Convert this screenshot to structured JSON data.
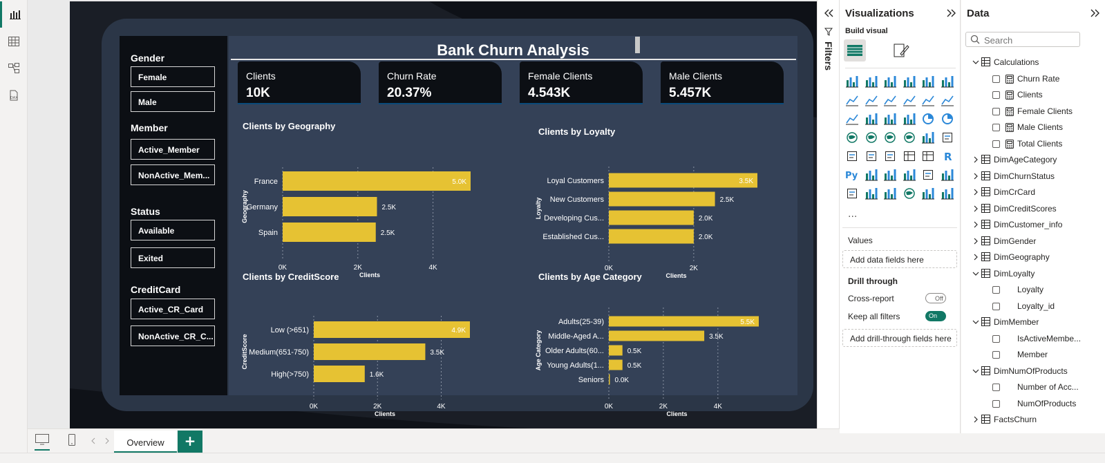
{
  "report": {
    "title": "Bank Churn Analysis",
    "slicers": [
      {
        "title": "Gender",
        "items": [
          "Female",
          "Male"
        ]
      },
      {
        "title": "Member",
        "items": [
          "Active_Member",
          "NonActive_Mem..."
        ]
      },
      {
        "title": "Status",
        "items": [
          "Available",
          "Exited"
        ]
      },
      {
        "title": "CreditCard",
        "items": [
          "Active_CR_Card",
          "NonActive_CR_C..."
        ]
      }
    ],
    "kpis": [
      {
        "label": "Clients",
        "value": "10K"
      },
      {
        "label": "Churn Rate",
        "value": "20.37%"
      },
      {
        "label": "Female Clients",
        "value": "4.543K"
      },
      {
        "label": "Male Clients",
        "value": "5.457K"
      }
    ]
  },
  "chart_data": [
    {
      "type": "bar",
      "orientation": "horizontal",
      "title": "Clients by Geography",
      "xlabel": "Clients",
      "ylabel": "Geography",
      "categories": [
        "France",
        "Germany",
        "Spain"
      ],
      "values": [
        5014,
        2509,
        2477
      ],
      "data_labels": [
        "5.0K",
        "2.5K",
        "2.5K"
      ],
      "xticks": [
        "0K",
        "2K",
        "4K"
      ],
      "xlim": [
        0,
        5000
      ],
      "bar_color": "#e6c233"
    },
    {
      "type": "bar",
      "orientation": "horizontal",
      "title": "Clients by Loyalty",
      "xlabel": "Clients",
      "ylabel": "Loyalty",
      "categories": [
        "Loyal Customers",
        "New Customers",
        "Developing Cus...",
        "Established Cus..."
      ],
      "values": [
        3500,
        2500,
        2000,
        2000
      ],
      "data_labels": [
        "3.5K",
        "2.5K",
        "2.0K",
        "2.0K"
      ],
      "xticks": [
        "0K",
        "2K"
      ],
      "xlim": [
        0,
        3500
      ],
      "bar_color": "#e6c233"
    },
    {
      "type": "bar",
      "orientation": "horizontal",
      "title": "Clients by CreditScore",
      "xlabel": "Clients",
      "ylabel": "CreditScore",
      "categories": [
        "Low (>651)",
        "Medium(651-750)",
        "High(>750)"
      ],
      "values": [
        4900,
        3500,
        1600
      ],
      "data_labels": [
        "4.9K",
        "3.5K",
        "1.6K"
      ],
      "xticks": [
        "0K",
        "2K",
        "4K"
      ],
      "xlim": [
        0,
        4900
      ],
      "bar_color": "#e6c233"
    },
    {
      "type": "bar",
      "orientation": "horizontal",
      "title": "Clients by Age Category",
      "xlabel": "Clients",
      "ylabel": "Age Category",
      "categories": [
        "Adults(25-39)",
        "Middle-Aged A...",
        "Older Adults(60...",
        "Young Adults(1...",
        "Seniors"
      ],
      "values": [
        5500,
        3500,
        500,
        500,
        20
      ],
      "data_labels": [
        "5.5K",
        "3.5K",
        "0.5K",
        "0.5K",
        "0.0K"
      ],
      "xticks": [
        "0K",
        "2K",
        "4K"
      ],
      "xlim": [
        0,
        5500
      ],
      "bar_color": "#e6c233"
    }
  ],
  "filters_label": "Filters",
  "viz_pane": {
    "title": "Visualizations",
    "build_visual": "Build visual",
    "more": "...",
    "values_label": "Values",
    "values_well": "Add data fields here",
    "drill_through": "Drill through",
    "cross_report": "Cross-report",
    "cross_report_state": "Off",
    "keep_filters": "Keep all filters",
    "keep_filters_state": "On",
    "drill_well": "Add drill-through fields here",
    "icons": [
      "stacked-bar-chart-icon",
      "stacked-column-chart-icon",
      "clustered-bar-chart-icon",
      "clustered-column-chart-icon",
      "100-stacked-bar-chart-icon",
      "100-stacked-column-chart-icon",
      "line-chart-icon",
      "area-chart-icon",
      "stacked-area-chart-icon",
      "100-stacked-area-chart-icon",
      "line-and-stacked-column-chart-icon",
      "line-and-clustered-column-chart-icon",
      "ribbon-chart-icon",
      "waterfall-chart-icon",
      "funnel-chart-icon",
      "scatter-chart-icon",
      "pie-chart-icon",
      "donut-chart-icon",
      "treemap-icon",
      "map-icon",
      "filled-map-icon",
      "azure-map-icon",
      "gauge-icon",
      "card-icon",
      "multi-row-card-icon",
      "kpi-icon",
      "slicer-icon",
      "table-icon",
      "matrix-icon",
      "r-visual-icon",
      "python-visual-icon",
      "key-influencers-icon",
      "decomposition-tree-icon",
      "qa-icon",
      "smart-narrative-icon",
      "metrics-icon",
      "paginated-report-icon",
      "power-apps-icon",
      "power-automate-icon",
      "arcgis-map-icon",
      "diamond-icon",
      "chevron-visual-icon"
    ]
  },
  "data_pane": {
    "title": "Data",
    "search_placeholder": "Search",
    "tree": [
      {
        "label": "Calculations",
        "level": 0,
        "expanded": true,
        "kind": "calc-table"
      },
      {
        "label": "Churn Rate",
        "level": 1,
        "kind": "measure"
      },
      {
        "label": "Clients",
        "level": 1,
        "kind": "measure"
      },
      {
        "label": "Female Clients",
        "level": 1,
        "kind": "measure"
      },
      {
        "label": "Male Clients",
        "level": 1,
        "kind": "measure"
      },
      {
        "label": "Total Clients",
        "level": 1,
        "kind": "measure"
      },
      {
        "label": "DimAgeCategory",
        "level": 0,
        "expanded": false,
        "kind": "table"
      },
      {
        "label": "DimChurnStatus",
        "level": 0,
        "expanded": false,
        "kind": "table"
      },
      {
        "label": "DimCrCard",
        "level": 0,
        "expanded": false,
        "kind": "table"
      },
      {
        "label": "DimCreditScores",
        "level": 0,
        "expanded": false,
        "kind": "table"
      },
      {
        "label": "DimCustomer_info",
        "level": 0,
        "expanded": false,
        "kind": "table"
      },
      {
        "label": "DimGender",
        "level": 0,
        "expanded": false,
        "kind": "table"
      },
      {
        "label": "DimGeography",
        "level": 0,
        "expanded": false,
        "kind": "table"
      },
      {
        "label": "DimLoyalty",
        "level": 0,
        "expanded": true,
        "kind": "table"
      },
      {
        "label": "Loyalty",
        "level": 1,
        "kind": "field"
      },
      {
        "label": "Loyalty_id",
        "level": 1,
        "kind": "field"
      },
      {
        "label": "DimMember",
        "level": 0,
        "expanded": true,
        "kind": "table"
      },
      {
        "label": "IsActiveMembe...",
        "level": 1,
        "kind": "field"
      },
      {
        "label": "Member",
        "level": 1,
        "kind": "field"
      },
      {
        "label": "DimNumOfProducts",
        "level": 0,
        "expanded": true,
        "kind": "table"
      },
      {
        "label": "Number of Acc...",
        "level": 1,
        "kind": "field"
      },
      {
        "label": "NumOfProducts",
        "level": 1,
        "kind": "field"
      },
      {
        "label": "FactsChurn",
        "level": 0,
        "expanded": false,
        "kind": "table"
      }
    ]
  },
  "bottom_bar": {
    "page_tab": "Overview",
    "add_page": "+"
  },
  "colors": {
    "accent": "#117865",
    "bar": "#e6c233",
    "panel": "#344157",
    "dark": "#0c0f14"
  }
}
